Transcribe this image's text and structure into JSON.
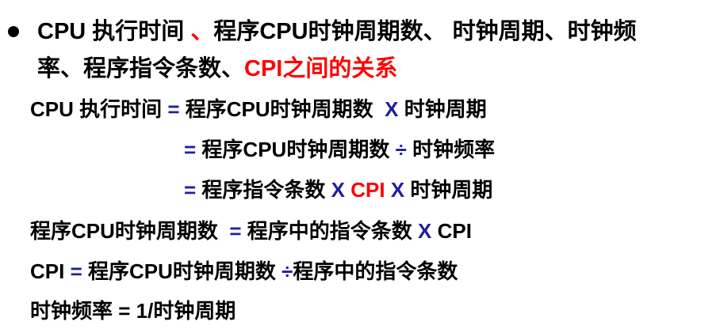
{
  "bullet": {
    "line1_part1": "CPU 执行时间",
    "line1_sep": " 、",
    "line1_part2": "程序CPU时钟周期数、 时钟周期、时钟频",
    "line2_part1": "率、程序指令条数、",
    "line2_highlight": "CPI之间的关系"
  },
  "formulas": [
    {
      "lhs": "CPU 执行时间",
      "eq": "=",
      "term1": "程序CPU时钟周期数",
      "op1": "X",
      "term2": "时钟周期"
    },
    {
      "eq": "=",
      "term1": "程序CPU时钟周期数",
      "op1": "÷",
      "term2": "时钟频率"
    },
    {
      "eq": "=",
      "term1": "程序指令条数",
      "op1": "X",
      "term2": "CPI",
      "op2": "X",
      "term3": "时钟周期"
    },
    {
      "lhs": "程序CPU时钟周期数",
      "eq": "=",
      "term1": "程序中的指令条数",
      "op1": "X",
      "term2": "CPI"
    },
    {
      "lhs": "CPI",
      "eq": "=",
      "term1": "程序CPU时钟周期数",
      "op1": "÷",
      "term2": "程序中的指令条数"
    },
    {
      "lhs": "时钟频率",
      "eq": "=",
      "term1": "1/时钟周期"
    }
  ],
  "colors": {
    "text": "#000000",
    "highlight_red": "#ff0000",
    "operator_blue": "#1f1fa0",
    "background": "#ffffff"
  }
}
